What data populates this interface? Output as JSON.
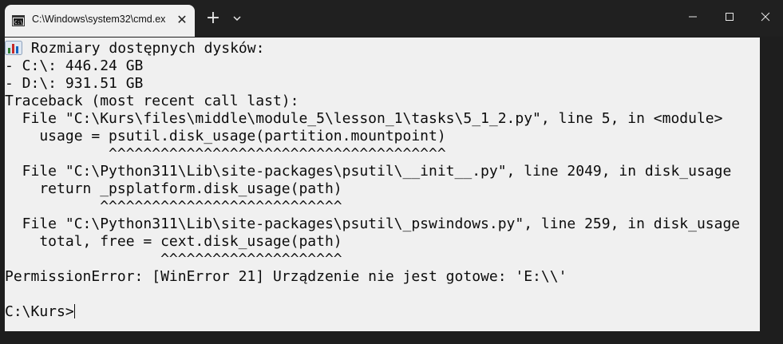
{
  "window": {
    "tab_title": "C:\\Windows\\system32\\cmd.ex",
    "tab_close": "✕",
    "new_tab": "+",
    "icons": {
      "terminal": "cmd-terminal-icon",
      "close_tab": "close-icon",
      "new_tab": "plus-icon",
      "dropdown": "chevron-down-icon",
      "minimize": "minimize-icon",
      "maximize": "maximize-icon",
      "close": "close-icon"
    }
  },
  "terminal": {
    "lines": [
      " Rozmiary dostępnych dysków:",
      "- C:\\: 446.24 GB",
      "- D:\\: 931.51 GB",
      "Traceback (most recent call last):",
      "  File \"C:\\Kurs\\files\\middle\\module_5\\lesson_1\\tasks\\5_1_2.py\", line 5, in <module>",
      "    usage = psutil.disk_usage(partition.mountpoint)",
      "            ^^^^^^^^^^^^^^^^^^^^^^^^^^^^^^^^^^^^^^^",
      "  File \"C:\\Python311\\Lib\\site-packages\\psutil\\__init__.py\", line 2049, in disk_usage",
      "    return _psplatform.disk_usage(path)",
      "           ^^^^^^^^^^^^^^^^^^^^^^^^^^^^",
      "  File \"C:\\Python311\\Lib\\site-packages\\psutil\\_pswindows.py\", line 259, in disk_usage",
      "    total, free = cext.disk_usage(path)",
      "                  ^^^^^^^^^^^^^^^^^^^^^",
      "PermissionError: [WinError 21] Urządzenie nie jest gotowe: 'E:\\\\'",
      "C:\\Kurs>"
    ],
    "chart_emoji_name": "bar-chart-icon"
  },
  "colors": {
    "titlebar": "#202020",
    "tab": "#f0f0f0",
    "terminal_bg": "#f0f0f0",
    "terminal_text": "#0c0c0c"
  }
}
